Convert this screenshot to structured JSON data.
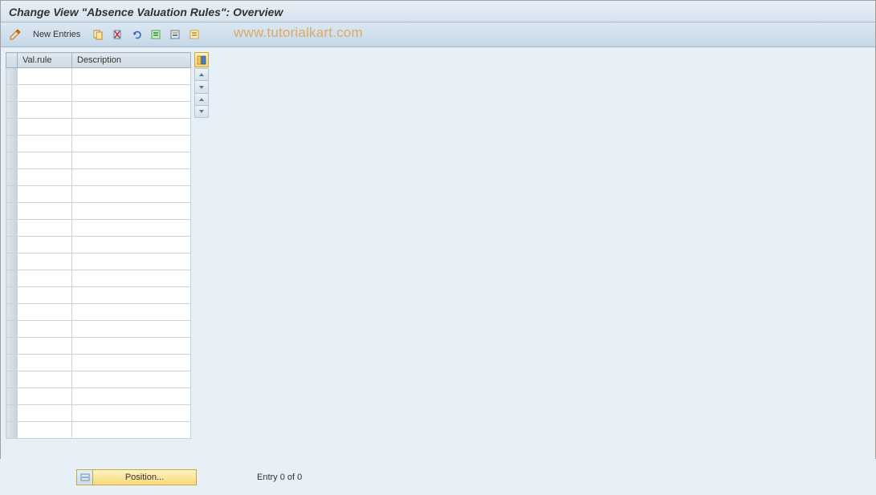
{
  "header": {
    "title": "Change View \"Absence Valuation Rules\": Overview"
  },
  "toolbar": {
    "new_entries_label": "New Entries",
    "watermark": "www.tutorialkart.com"
  },
  "table": {
    "columns": {
      "val_rule": "Val.rule",
      "description": "Description"
    },
    "row_count": 22
  },
  "footer": {
    "position_label": "Position...",
    "entry_status": "Entry 0 of 0"
  }
}
